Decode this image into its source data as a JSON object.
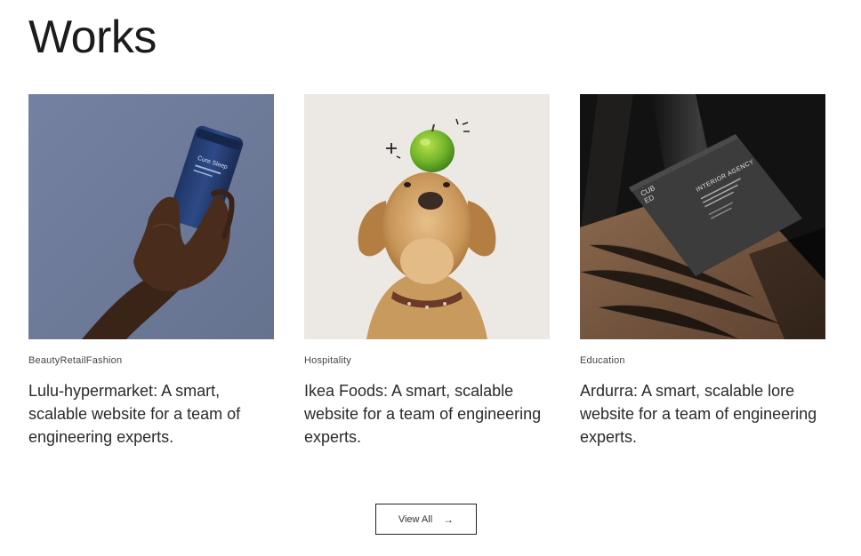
{
  "section": {
    "title": "Works"
  },
  "works": [
    {
      "tag": "BeautyRetailFashion",
      "title": "Lulu-hypermarket: A smart, scalable website for a team of engineering experts.",
      "image": "hand-holding-jar-photo",
      "jar_label": "Cure Sleep"
    },
    {
      "tag": "Hospitality",
      "title": "Ikea Foods: A smart, scalable website for a team of engineering experts.",
      "image": "dog-with-apple-photo"
    },
    {
      "tag": "Education",
      "title": "Ardurra: A smart, scalable lore website for a team of engineering experts.",
      "image": "business-card-on-wood-photo",
      "card_logo_line1": "CUB",
      "card_logo_line2": "ED",
      "card_heading": "INTERIOR AGENCY"
    }
  ],
  "view_all": {
    "label": "View All",
    "icon": "arrow-right-icon"
  },
  "colors": {
    "text": "#222222",
    "background": "#ffffff",
    "photo1_bg": "#6f7b9c",
    "photo2_bg": "#ece9e4",
    "photo3_bg": "#141414"
  }
}
